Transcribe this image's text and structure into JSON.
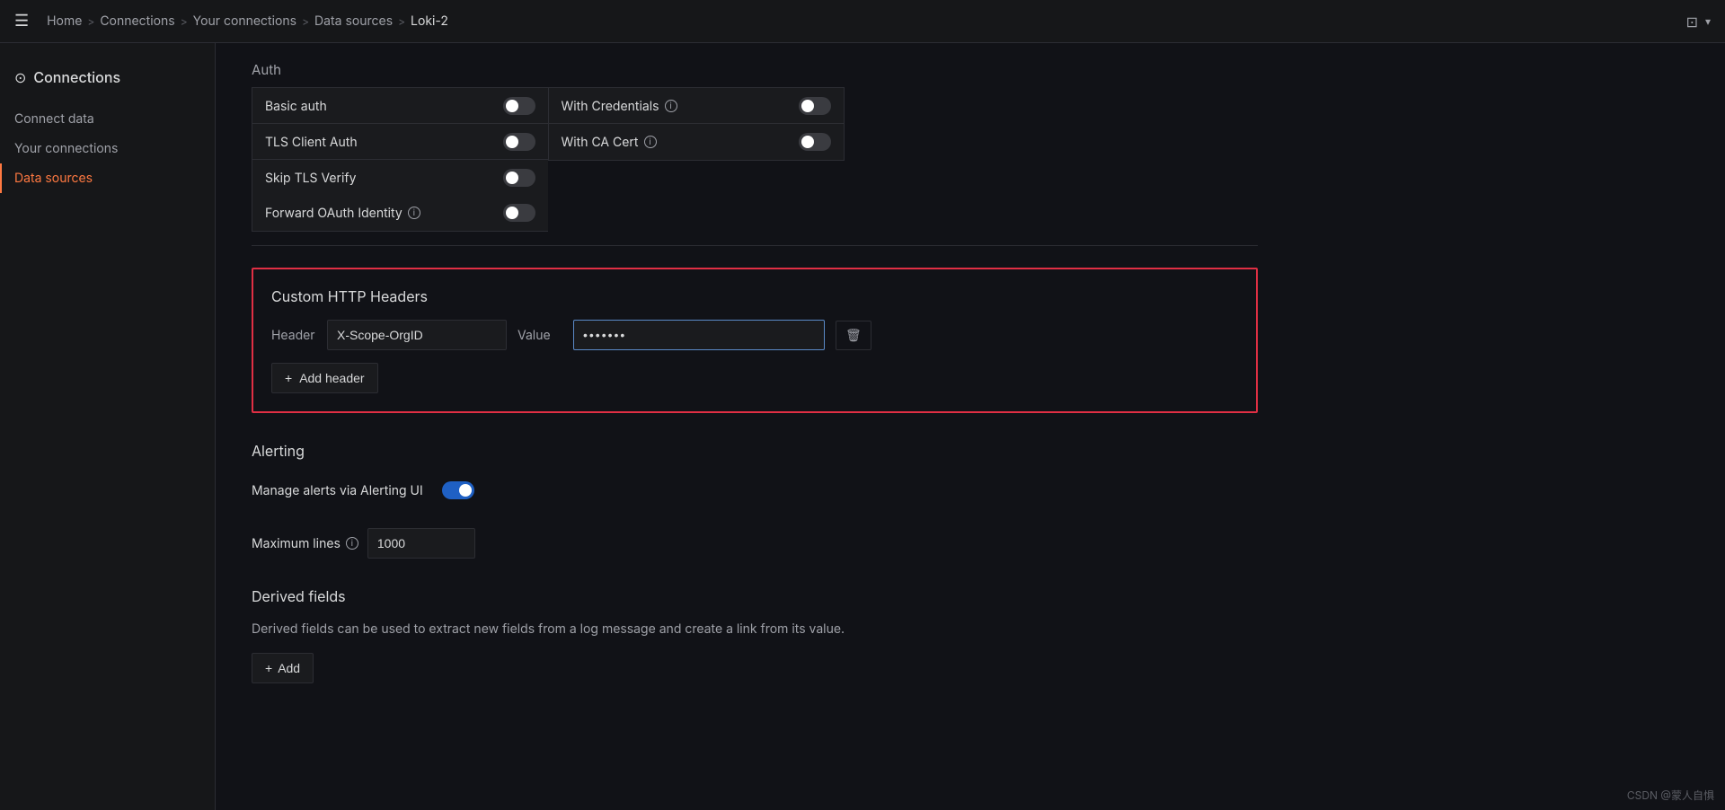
{
  "topbar": {
    "breadcrumbs": [
      "Home",
      "Connections",
      "Your connections",
      "Data sources",
      "Loki-2"
    ]
  },
  "sidebar": {
    "title": "Connections",
    "items": [
      {
        "id": "connect-data",
        "label": "Connect data"
      },
      {
        "id": "your-connections",
        "label": "Your connections"
      },
      {
        "id": "data-sources",
        "label": "Data sources",
        "active": true
      }
    ]
  },
  "auth": {
    "title": "Auth",
    "rows_left": [
      {
        "label": "Basic auth",
        "enabled": false
      },
      {
        "label": "TLS Client Auth",
        "enabled": false
      },
      {
        "label": "Skip TLS Verify",
        "enabled": false
      },
      {
        "label": "Forward OAuth Identity",
        "enabled": false,
        "hasInfo": true
      }
    ],
    "rows_right": [
      {
        "label": "With Credentials",
        "enabled": false,
        "hasInfo": true
      },
      {
        "label": "With CA Cert",
        "enabled": false,
        "hasInfo": true
      }
    ]
  },
  "custom_headers": {
    "title": "Custom HTTP Headers",
    "header_label": "Header",
    "header_value": "X-Scope-OrgID",
    "value_label": "Value",
    "value_placeholder": "●●●●●●●",
    "add_button": "+ Add header"
  },
  "alerting": {
    "title": "Alerting",
    "manage_alerts_label": "Manage alerts via Alerting UI",
    "manage_alerts_enabled": true
  },
  "max_lines": {
    "label": "Maximum lines",
    "value": "1000"
  },
  "derived_fields": {
    "title": "Derived fields",
    "description": "Derived fields can be used to extract new fields from a log message and create a link from its value.",
    "add_button": "+ Add"
  },
  "watermark": "CSDN @蒙人自惧",
  "icons": {
    "hamburger": "☰",
    "connections": "⊙",
    "breadcrumb_sep": ">",
    "info": "i",
    "trash": "🗑",
    "plus": "+"
  }
}
